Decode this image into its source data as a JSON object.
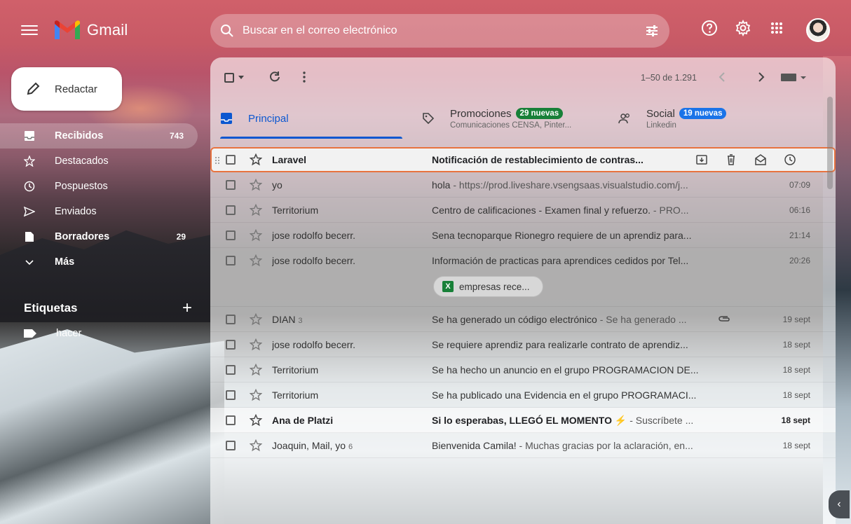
{
  "app": {
    "name": "Gmail"
  },
  "search": {
    "placeholder": "Buscar en el correo electrónico"
  },
  "compose": {
    "label": "Redactar"
  },
  "sidebar": {
    "items": [
      {
        "label": "Recibidos",
        "count": "743"
      },
      {
        "label": "Destacados",
        "count": ""
      },
      {
        "label": "Pospuestos",
        "count": ""
      },
      {
        "label": "Enviados",
        "count": ""
      },
      {
        "label": "Borradores",
        "count": "29"
      },
      {
        "label": "Más",
        "count": ""
      }
    ],
    "labels_title": "Etiquetas",
    "labels": [
      {
        "label": "hacer"
      }
    ]
  },
  "toolbar": {
    "range": "1–50 de 1.291"
  },
  "tabs": [
    {
      "name": "Principal",
      "badge": "",
      "sub": ""
    },
    {
      "name": "Promociones",
      "badge": "29 nuevas",
      "sub": "Comunicaciones CENSA, Pinter..."
    },
    {
      "name": "Social",
      "badge": "19 nuevas",
      "sub": "Linkedin"
    }
  ],
  "emails": [
    {
      "sender": "Laravel",
      "count": "",
      "subject": "Notificación de restablecimiento de contras...",
      "snippet": "",
      "time": ""
    },
    {
      "sender": "yo",
      "count": "",
      "subject": "hola",
      "snippet": " - https://prod.liveshare.vsengsaas.visualstudio.com/j...",
      "time": "07:09"
    },
    {
      "sender": "Territorium",
      "count": "",
      "subject": "Centro de calificaciones - Examen final y refuerzo.",
      "snippet": " - PRO...",
      "time": "06:16"
    },
    {
      "sender": "jose rodolfo becerr.",
      "count": "",
      "subject": "Sena tecnoparque Rionegro requiere de un aprendiz para...",
      "snippet": "",
      "time": "21:14"
    },
    {
      "sender": "jose rodolfo becerr.",
      "count": "",
      "subject": "Información de practicas para aprendices cedidos por Tel...",
      "snippet": "",
      "time": "20:26",
      "attachment": "empresas rece..."
    },
    {
      "sender": "DIAN",
      "count": "3",
      "subject": "Se ha generado un código electrónico",
      "snippet": " - Se ha generado ...",
      "time": "19 sept"
    },
    {
      "sender": "jose rodolfo becerr.",
      "count": "",
      "subject": "Se requiere aprendiz para realizarle contrato de aprendiz...",
      "snippet": "",
      "time": "18 sept"
    },
    {
      "sender": "Territorium",
      "count": "",
      "subject": "Se ha hecho un anuncio en el grupo PROGRAMACION DE...",
      "snippet": "",
      "time": "18 sept"
    },
    {
      "sender": "Territorium",
      "count": "",
      "subject": "Se ha publicado una Evidencia en el grupo PROGRAMACI...",
      "snippet": "",
      "time": "18 sept"
    },
    {
      "sender": "Ana de Platzi",
      "count": "",
      "subject": "Si lo esperabas, LLEGÓ EL MOMENTO ⚡",
      "snippet": " - Suscríbete ...",
      "time": "18 sept"
    },
    {
      "sender": "Joaquin, Mail, yo",
      "count": "6",
      "subject": "Bienvenida Camila!",
      "snippet": " - Muchas gracias por la aclaración, en...",
      "time": "18 sept"
    }
  ],
  "colors": {
    "accent": "#0b57d0",
    "highlight": "#e8733f",
    "promo_badge": "#188038",
    "social_badge": "#1a73e8"
  }
}
